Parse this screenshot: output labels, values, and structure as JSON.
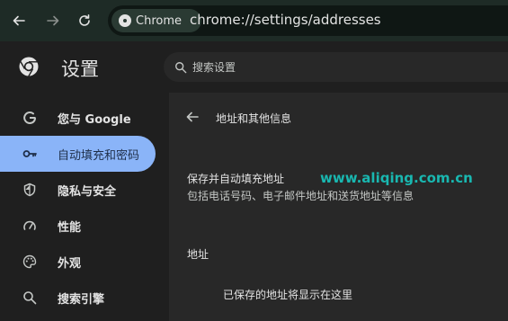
{
  "browser": {
    "chip_label": "Chrome",
    "url": "chrome://settings/addresses"
  },
  "header": {
    "title": "设置",
    "search_placeholder": "搜索设置"
  },
  "sidebar": {
    "items": [
      {
        "label": "您与 Google",
        "icon": "google-icon"
      },
      {
        "label": "自动填充和密码",
        "icon": "key-icon",
        "active": true
      },
      {
        "label": "隐私与安全",
        "icon": "shield-icon"
      },
      {
        "label": "性能",
        "icon": "speedometer-icon"
      },
      {
        "label": "外观",
        "icon": "palette-icon"
      },
      {
        "label": "搜索引擎",
        "icon": "search-icon"
      }
    ]
  },
  "main": {
    "section_title": "地址和其他信息",
    "toggle_title": "保存并自动填充地址",
    "toggle_desc": "包括电话号码、电子邮件地址和送货地址等信息",
    "addresses_label": "地址",
    "empty_message": "已保存的地址将显示在这里"
  },
  "watermark": "www.aliqing.com.cn",
  "colors": {
    "active_item_bg": "#8ab4f8",
    "watermark": "#19b7b0",
    "toolbar_bg": "#1e2b26",
    "main_bg": "#282828"
  }
}
